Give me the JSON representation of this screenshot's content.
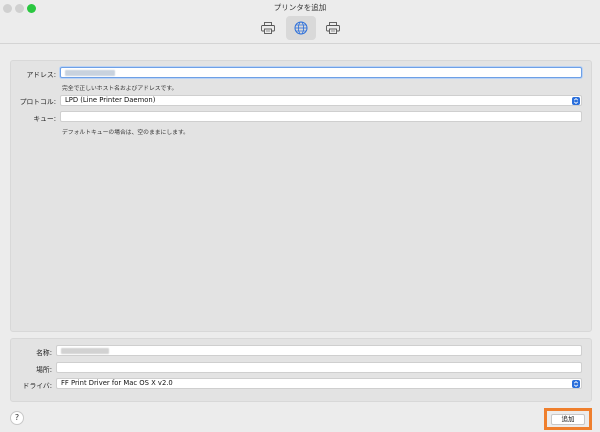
{
  "window": {
    "title": "プリンタを追加"
  },
  "toolbar": {
    "items": [
      {
        "name": "default",
        "icon": "printer-icon",
        "active": false
      },
      {
        "name": "ip",
        "icon": "globe-icon",
        "active": true
      },
      {
        "name": "windows",
        "icon": "printer-icon",
        "active": false
      }
    ]
  },
  "form": {
    "address_label": "アドレス:",
    "address_hint": "完全で正しいホスト名およびアドレスです。",
    "protocol_label": "プロトコル:",
    "protocol_value": "LPD (Line Printer Daemon)",
    "queue_label": "キュー:",
    "queue_value": "",
    "queue_hint": "デフォルトキューの場合は、空のままにします。"
  },
  "details": {
    "name_label": "名称:",
    "location_label": "場所:",
    "location_value": "",
    "driver_label": "ドライバ:",
    "driver_value": "FF Print Driver for Mac OS X v2.0"
  },
  "footer": {
    "help_label": "?",
    "add_label": "追加"
  },
  "colors": {
    "accent": "#2b6fdb",
    "highlight": "#ef7f2d",
    "focus_ring": "#6ea0e6"
  }
}
